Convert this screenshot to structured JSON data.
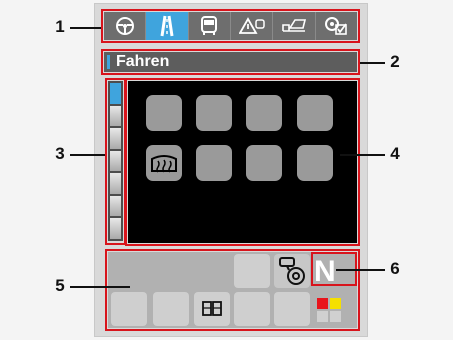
{
  "callouts": [
    "1",
    "2",
    "3",
    "4",
    "5",
    "6"
  ],
  "tabs": [
    {
      "icon": "steering-wheel-icon",
      "active": false
    },
    {
      "icon": "road-icon",
      "active": true
    },
    {
      "icon": "bus-icon",
      "active": false
    },
    {
      "icon": "warning-triangle-icon",
      "active": false
    },
    {
      "icon": "tipper-truck-icon",
      "active": false
    },
    {
      "icon": "settings-check-icon",
      "active": false
    }
  ],
  "mode_title": "Fahren",
  "gear": "N",
  "colors": {
    "highlight": "#d8141c",
    "active_tab": "#3fa4dd",
    "status_red": "#e8141c",
    "status_yellow": "#f5e000"
  }
}
